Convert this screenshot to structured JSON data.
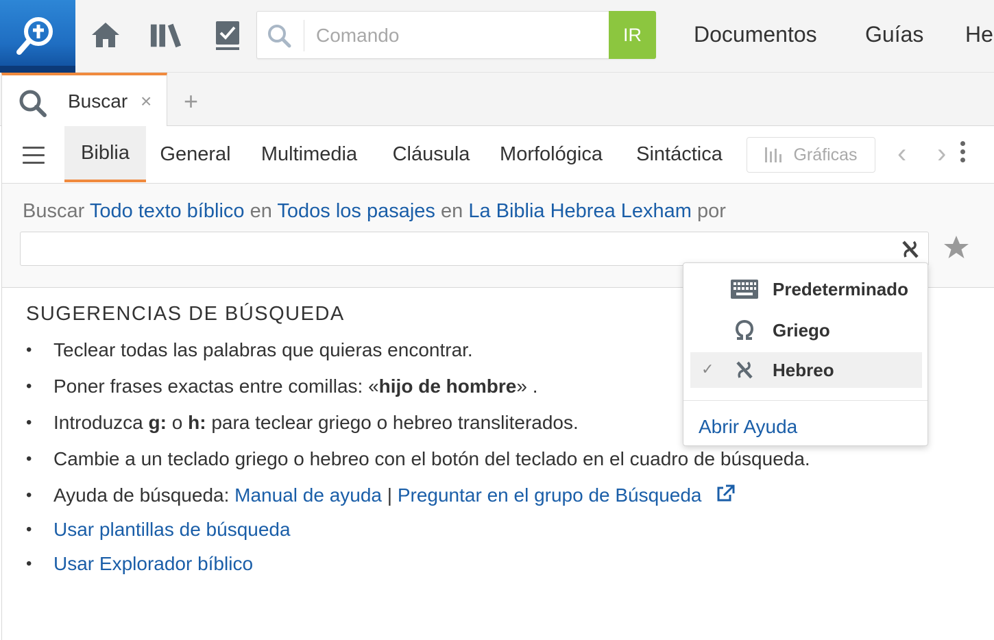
{
  "toolbar": {
    "logo_icon": "logos-search-logo-icon",
    "home_icon": "home-icon",
    "library_icon": "library-icon",
    "tasks_icon": "checklist-icon",
    "command_placeholder": "Comando",
    "go_label": "IR",
    "go_color": "#8cc63f",
    "nav": [
      "Documentos",
      "Guías",
      "He"
    ]
  },
  "tabs": {
    "active_label": "Buscar",
    "close_glyph": "×",
    "add_glyph": "+",
    "accent_color": "#f08a3e"
  },
  "search_types": {
    "items": [
      "Biblia",
      "General",
      "Multimedia",
      "Cláusula",
      "Morfológica",
      "Sintáctica"
    ],
    "active": "Biblia",
    "charts_label": "Gráficas",
    "prev_glyph": "‹",
    "next_glyph": "›"
  },
  "query": {
    "prefix": "Buscar",
    "scope": "Todo texto bíblico",
    "in1": "en",
    "range": "Todos los pasajes",
    "in2": "en",
    "resource": "La Biblia Hebrea Lexham",
    "by": "por",
    "input_value": "",
    "keyboard_icon": "hebrew-aleph-keyboard-icon",
    "favorite_icon": "star-icon"
  },
  "suggestions": {
    "title": "SUGERENCIAS DE BÚSQUEDA",
    "item1": "Teclear todas las palabras que quieras encontrar.",
    "item2_pre": "Poner frases exactas entre comillas:  «",
    "item2_bold": "hijo de hombre",
    "item2_post": "» .",
    "item3_pre": "Introduzca ",
    "item3_g": "g:",
    "item3_mid": " o ",
    "item3_h": "h:",
    "item3_post": " para teclear griego o hebreo transliterados.",
    "item4": "Cambie a un teclado griego o hebreo con el botón del teclado en el cuadro de búsqueda.",
    "item5_pre": "Ayuda de búsqueda: ",
    "item5_link1": "Manual de ayuda",
    "item5_sep": " | ",
    "item5_link2": "Preguntar en el grupo de Búsqueda",
    "item6": "Usar plantillas de búsqueda",
    "item7": "Usar Explorador bíblico",
    "link_color": "#1a5ea8"
  },
  "keyboard_menu": {
    "options": [
      {
        "label": "Predeterminado",
        "icon": "keyboard-icon",
        "selected": false
      },
      {
        "label": "Griego",
        "icon": "omega-icon",
        "selected": false
      },
      {
        "label": "Hebreo",
        "icon": "aleph-icon",
        "selected": true
      }
    ],
    "check_glyph": "✓",
    "help_label": "Abrir Ayuda"
  }
}
